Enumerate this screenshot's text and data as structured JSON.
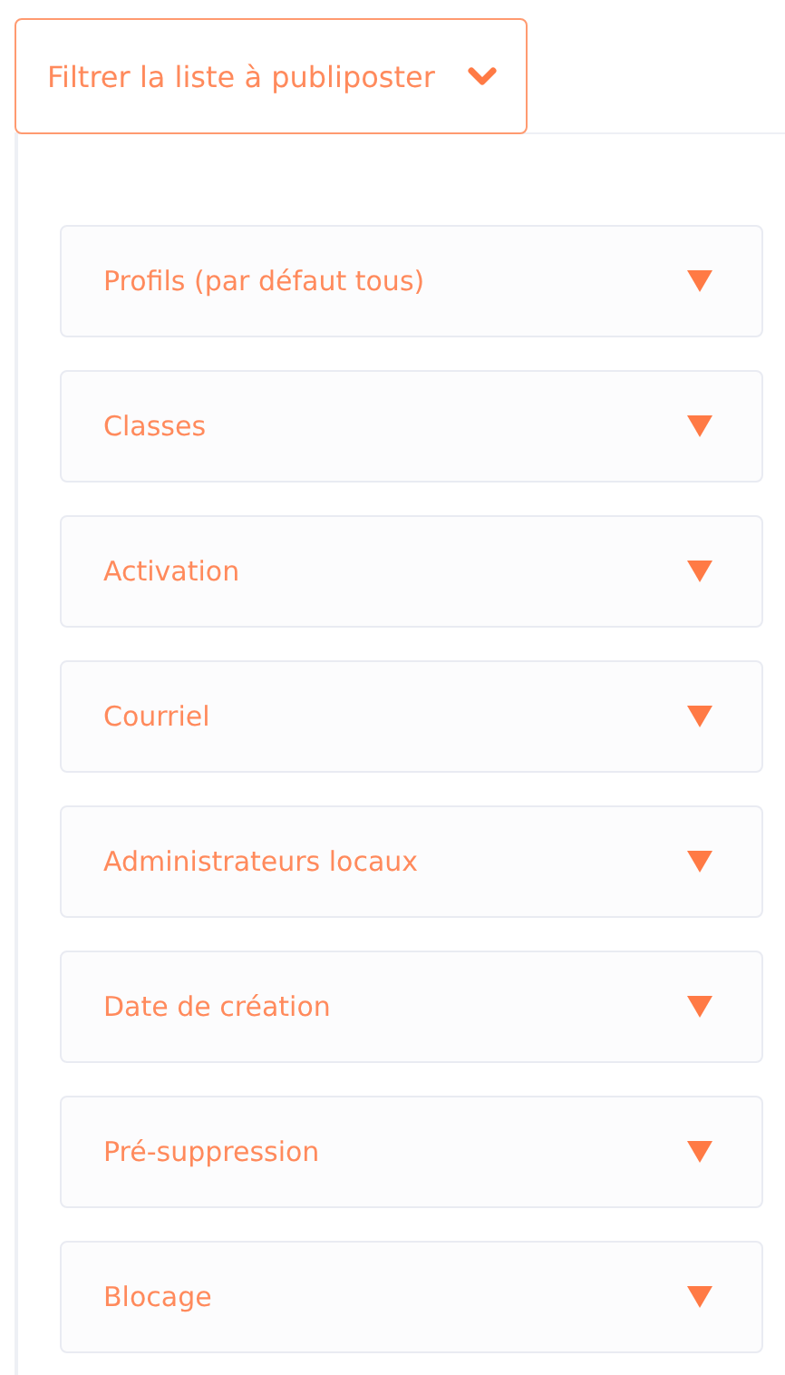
{
  "filter_button": {
    "label": "Filtrer la liste à publiposter",
    "expanded": true
  },
  "sections": [
    {
      "label": "Profils (par défaut tous)",
      "expanded": false
    },
    {
      "label": "Classes",
      "expanded": false
    },
    {
      "label": "Activation",
      "expanded": false
    },
    {
      "label": "Courriel",
      "expanded": false
    },
    {
      "label": "Administrateurs locaux",
      "expanded": false
    },
    {
      "label": "Date de création",
      "expanded": false
    },
    {
      "label": "Pré-suppression",
      "expanded": false
    },
    {
      "label": "Blocage",
      "expanded": false
    }
  ]
}
